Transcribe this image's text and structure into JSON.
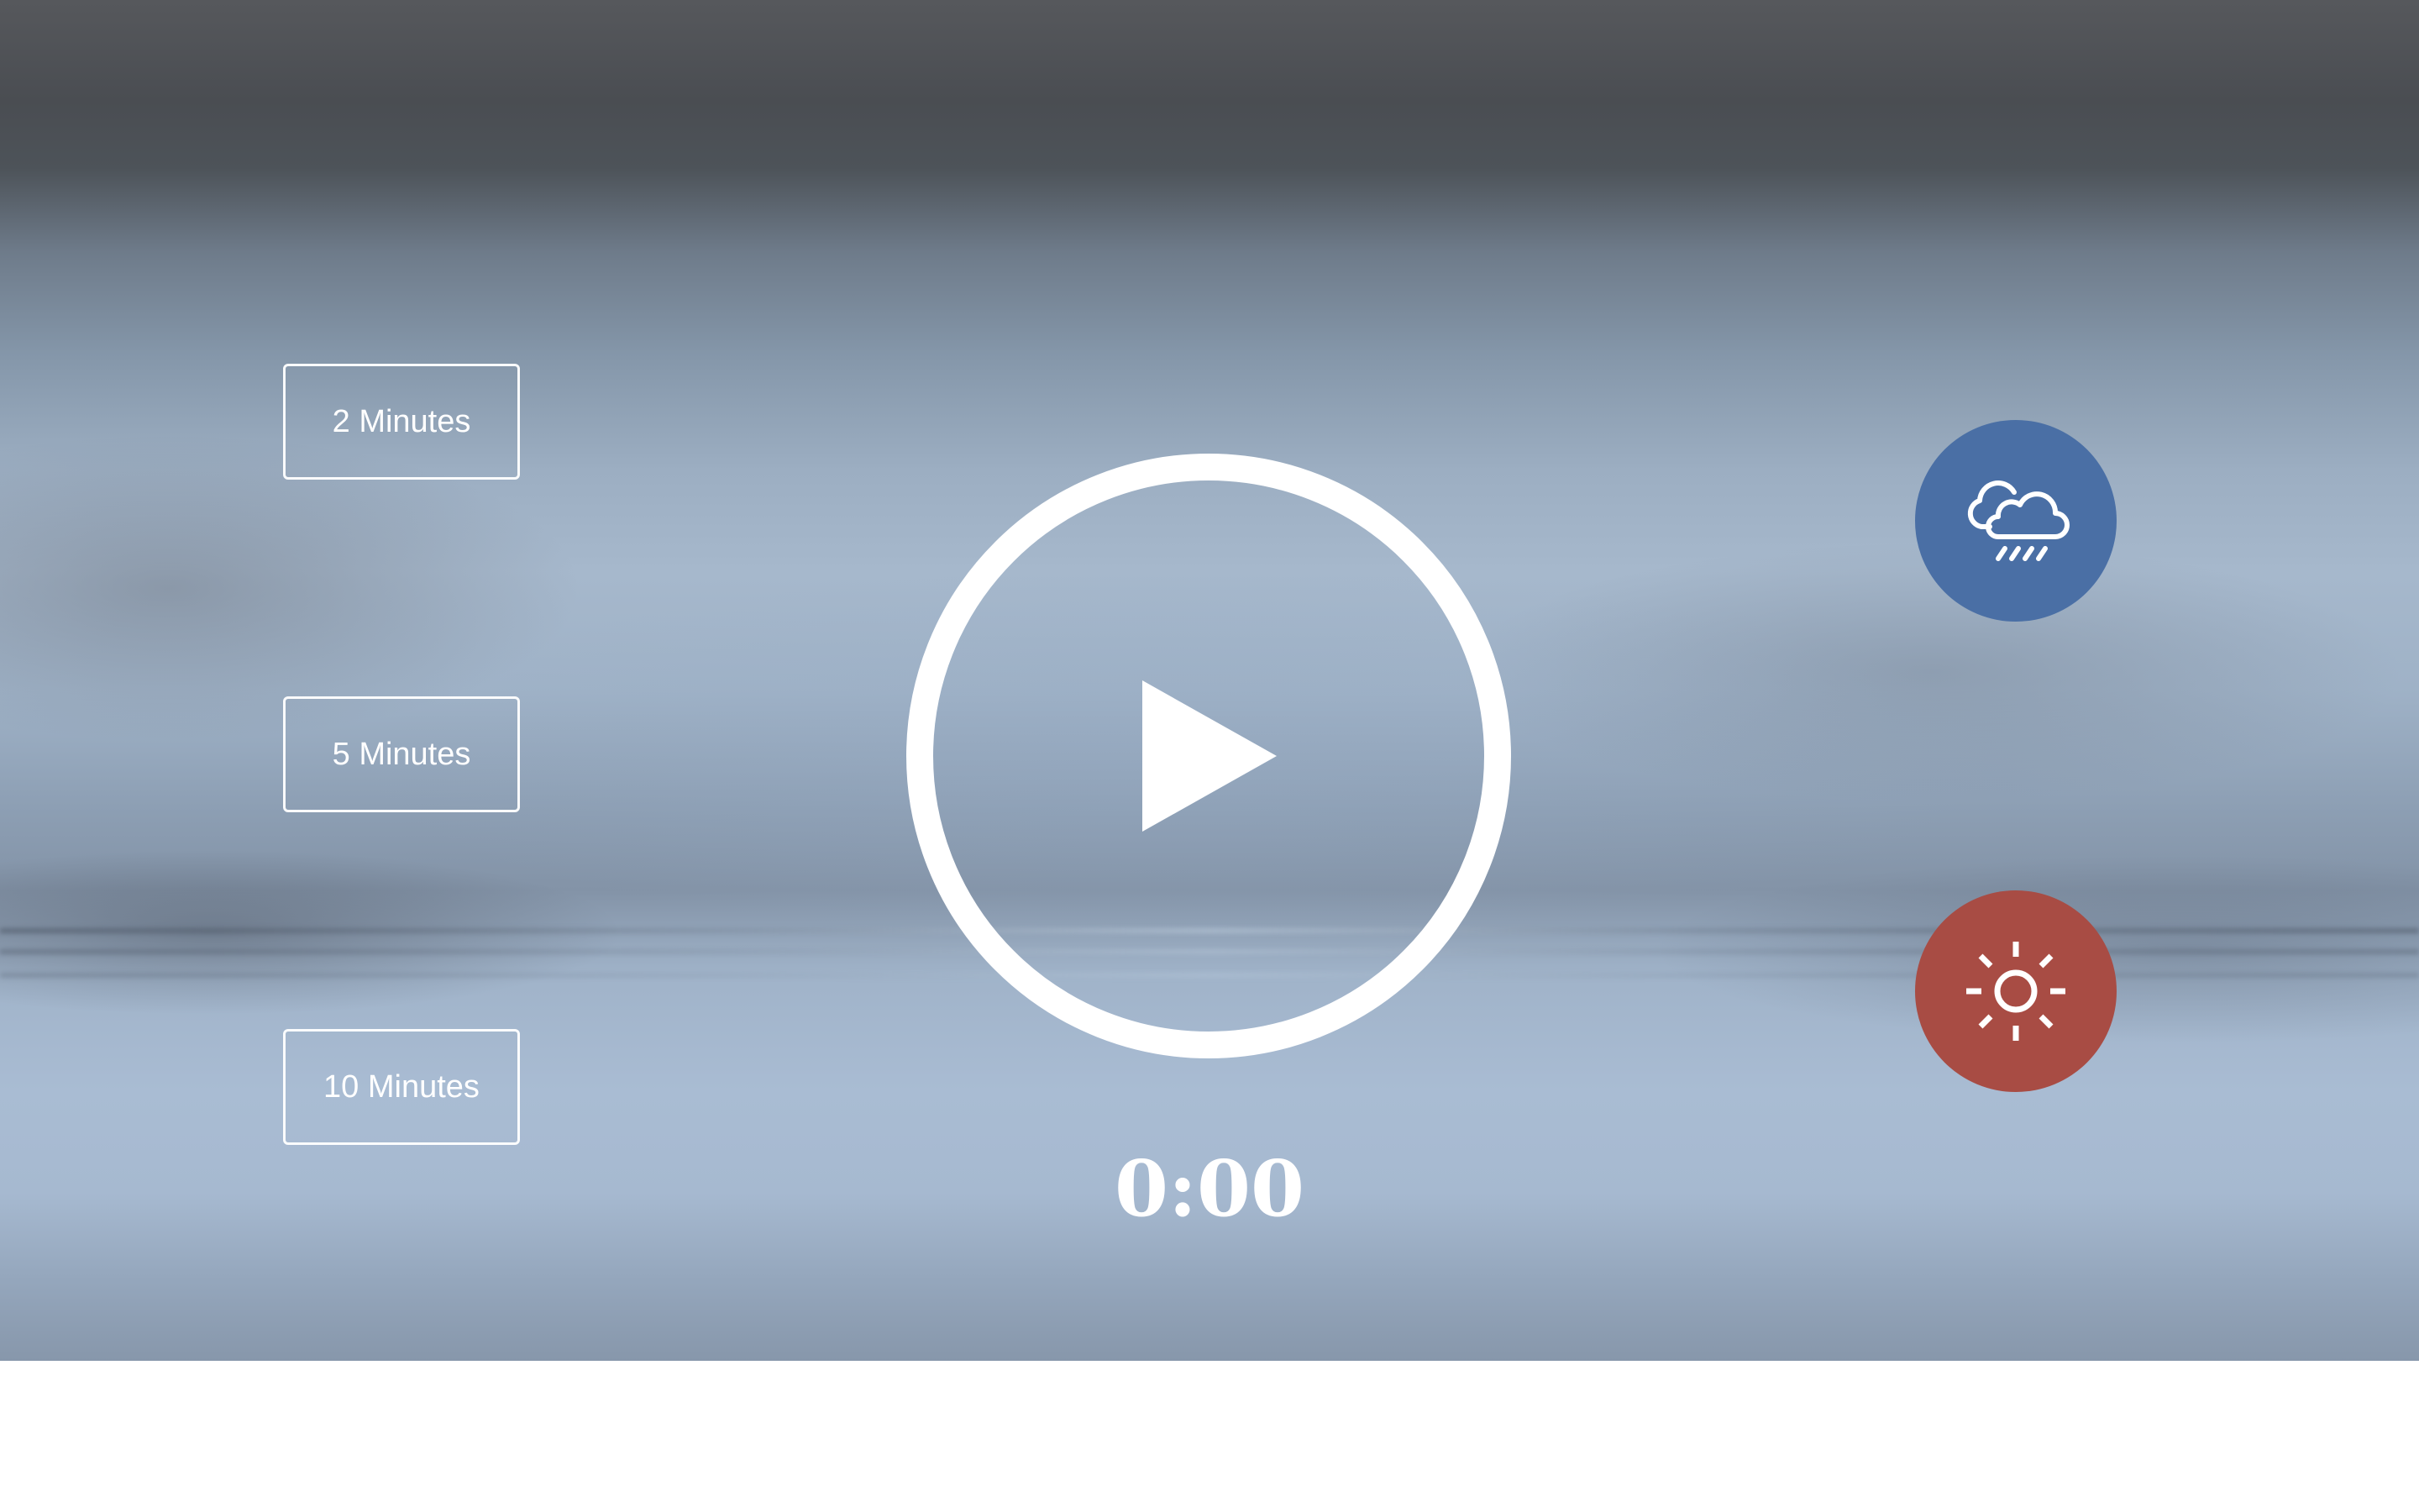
{
  "durations": [
    {
      "label": "2 Minutes"
    },
    {
      "label": "5 Minutes"
    },
    {
      "label": "10 Minutes"
    }
  ],
  "player": {
    "play_icon": "play-icon",
    "timer": "0:00"
  },
  "sounds": [
    {
      "name": "rain",
      "icon": "cloud-rain-icon",
      "color": "#4a6fa5"
    },
    {
      "name": "summer",
      "icon": "sun-icon",
      "color": "#a84c44"
    }
  ]
}
